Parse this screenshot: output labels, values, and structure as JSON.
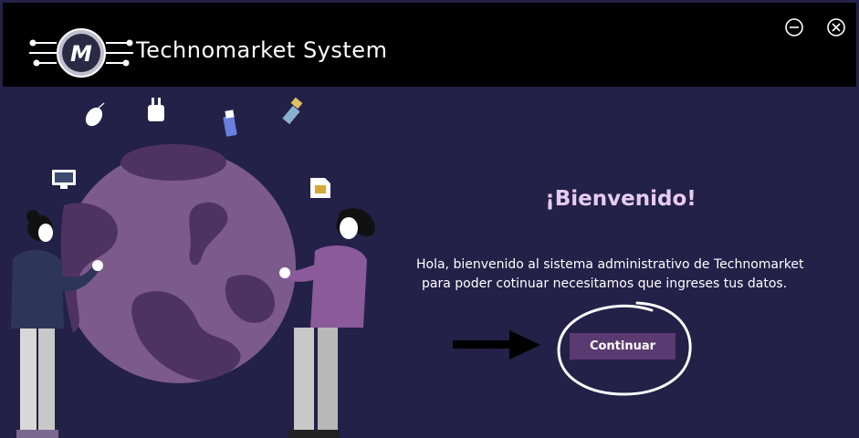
{
  "window": {
    "title": "Technomarket System",
    "logo_letter": "M"
  },
  "welcome": {
    "heading": "¡Bienvenido!",
    "message_line1": "Hola, bienvenido al sistema administrativo de Technomarket",
    "message_line2": "para poder cotinuar necesitamos que ingreses tus datos.",
    "continue_label": "Continuar"
  },
  "colors": {
    "background": "#232148",
    "titlebar": "#000000",
    "heading": "#e6ccf0",
    "button": "#5a3a70",
    "globe": "#7d5a8c",
    "globe_dark": "#4e3361"
  }
}
